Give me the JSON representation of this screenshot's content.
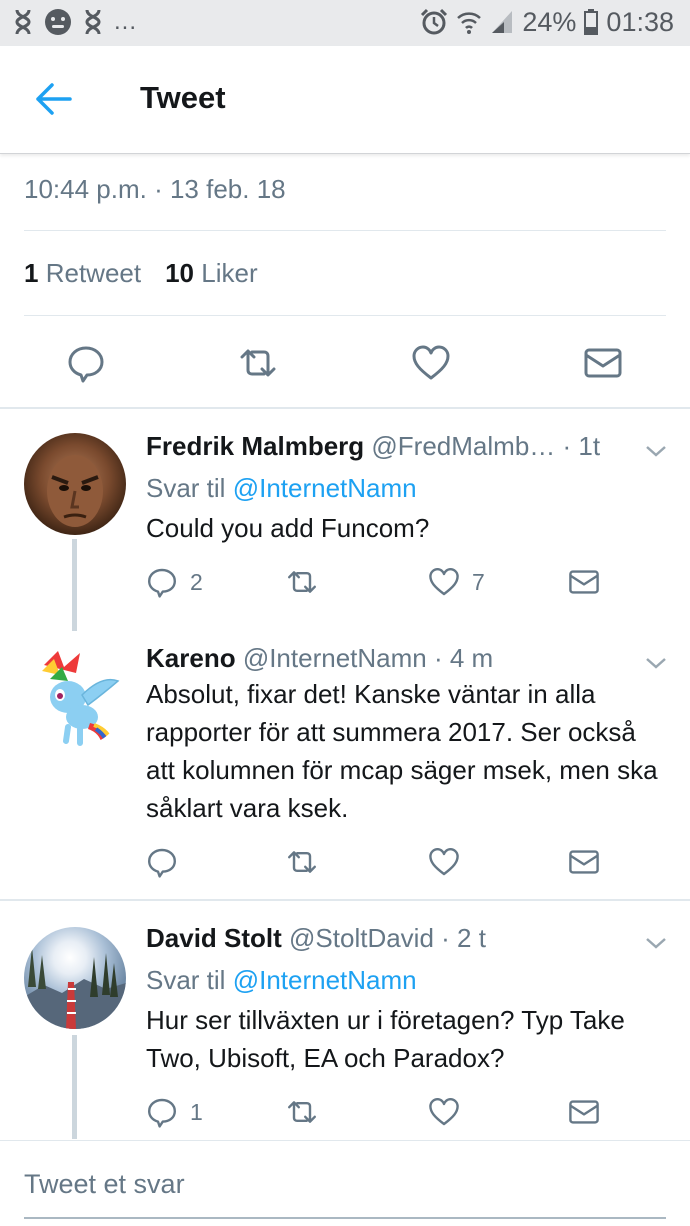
{
  "status_bar": {
    "left_icons": [
      "dna-icon",
      "face-icon",
      "dna-icon"
    ],
    "overflow": "...",
    "battery_pct": "24%",
    "time": "01:38"
  },
  "header": {
    "title": "Tweet"
  },
  "main_tweet": {
    "timestamp": "10:44 p.m. · 13 feb. 18",
    "retweets_count": "1",
    "retweets_label": "Retweet",
    "likes_count": "10",
    "likes_label": "Liker"
  },
  "replies": [
    {
      "name": "Fredrik Malmberg",
      "handle": "@FredMalmb…",
      "time": "· 1t",
      "reply_prefix": "Svar til",
      "reply_mention": "@InternetNamn",
      "text": "Could you add Funcom?",
      "reply_count": "2",
      "retweet_count": "",
      "like_count": "7"
    },
    {
      "name": "Kareno",
      "handle": "@InternetNamn",
      "time": "· 4 m",
      "text": "Absolut, fixar det! Kanske väntar in alla rapporter för att summera 2017. Ser också att kolumnen för mcap säger msek, men ska såklart vara ksek.",
      "reply_count": "",
      "retweet_count": "",
      "like_count": ""
    },
    {
      "name": "David Stolt",
      "handle": "@StoltDavid",
      "time": "· 2 t",
      "reply_prefix": "Svar til",
      "reply_mention": "@InternetNamn",
      "text": "Hur ser tillväxten ur i företagen? Typ Take Two, Ubisoft, EA och Paradox?",
      "reply_count": "1",
      "retweet_count": "",
      "like_count": ""
    }
  ],
  "reply_box": {
    "placeholder": "Tweet et svar"
  },
  "colors": {
    "accent": "#1da1f2",
    "muted": "#657786",
    "text": "#14171a",
    "divider": "#e1e8ed"
  }
}
